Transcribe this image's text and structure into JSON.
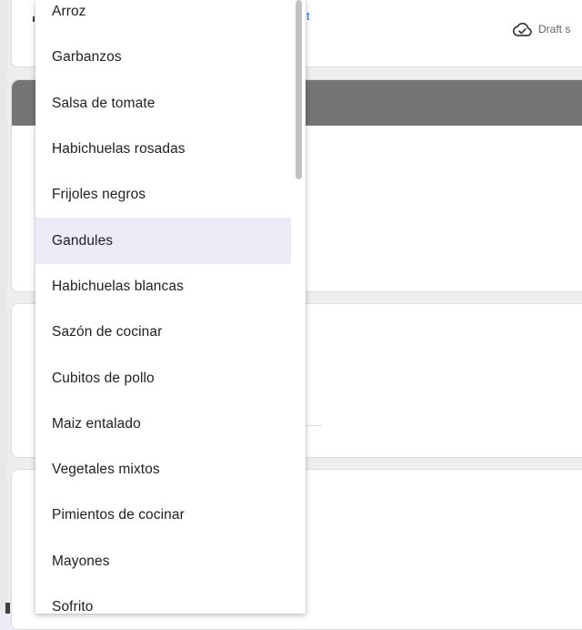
{
  "background": {
    "draft_status": "Draft s",
    "link_fragment": "t"
  },
  "dropdown": {
    "selected_index": 5,
    "options": [
      {
        "label": "Arroz"
      },
      {
        "label": "Garbanzos"
      },
      {
        "label": "Salsa de tomate"
      },
      {
        "label": "Habichuelas rosadas"
      },
      {
        "label": "Frijoles negros"
      },
      {
        "label": "Gandules"
      },
      {
        "label": "Habichuelas blancas"
      },
      {
        "label": "Sazón de cocinar"
      },
      {
        "label": "Cubitos de pollo"
      },
      {
        "label": "Maiz entalado"
      },
      {
        "label": "Vegetales mixtos"
      },
      {
        "label": "Pimientos de cocinar"
      },
      {
        "label": "Mayones"
      },
      {
        "label": "Sofrito"
      }
    ]
  },
  "colors": {
    "selected_bg": "#ecebf8",
    "header_band": "#757575",
    "link": "#1a73e8"
  },
  "icons": {
    "draft": "cloud-check-icon"
  }
}
